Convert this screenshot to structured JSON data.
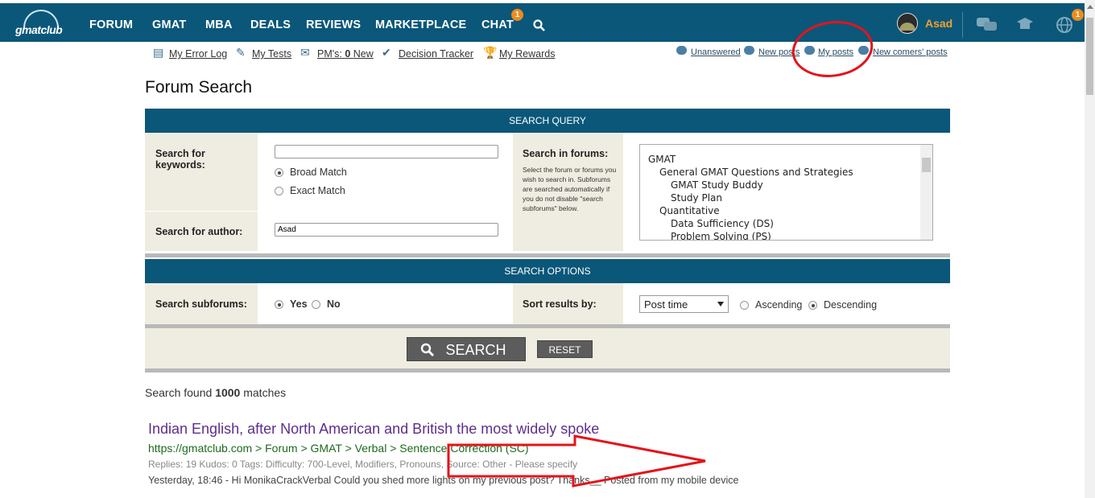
{
  "header": {
    "logo_text": "gmatclub",
    "nav": [
      "FORUM",
      "GMAT",
      "MBA",
      "DEALS",
      "REVIEWS",
      "MARKETPLACE",
      "CHAT"
    ],
    "chat_badge": "1",
    "username": "Asad",
    "globe_badge": "1"
  },
  "sublinks": {
    "error_log": "My Error Log",
    "tests": "My Tests",
    "pms_prefix": "PM's:",
    "pms_count": "0",
    "pms_new": "New",
    "decision_tracker": "Decision Tracker",
    "rewards": "My Rewards"
  },
  "quicklinks": {
    "unanswered": "Unanswered",
    "new_posts": "New posts",
    "my_posts": "My posts",
    "new_comers": "New comers' posts"
  },
  "page_title": "Forum Search",
  "query": {
    "header": "SEARCH QUERY",
    "keywords_label": "Search for keywords:",
    "keywords_value": "",
    "broad": "Broad Match",
    "exact": "Exact Match",
    "author_label": "Search for author:",
    "author_value": "Asad",
    "forums_label": "Search in forums:",
    "forums_help": "Select the forum or forums you wish to search in. Subforums are searched automatically if you do not disable \"search subforums\" below.",
    "forums": [
      "GMAT",
      "General GMAT Questions and Strategies",
      "GMAT Study Buddy",
      "Study Plan",
      "Quantitative",
      "Data Sufficiency (DS)",
      "Problem Solving (PS)"
    ]
  },
  "options": {
    "header": "SEARCH OPTIONS",
    "subforums_label": "Search subforums:",
    "yes": "Yes",
    "no": "No",
    "sort_label": "Sort results by:",
    "sort_value": "Post time",
    "ascending": "Ascending",
    "descending": "Descending"
  },
  "buttons": {
    "search": "SEARCH",
    "reset": "RESET"
  },
  "results": {
    "found_prefix": "Search found",
    "found_count": "1000",
    "found_suffix": "matches",
    "items": [
      {
        "title": "Indian English, after North American and British the most widely spoke",
        "url": "https://gmatclub.com > Forum > GMAT > Verbal > Sentence Correction (SC)",
        "meta": "Replies: 19   Kudos: 0   Tags: Difficulty: 700-Level,  Modifiers,  Pronouns,  Source: Other - Please specify",
        "snippet": "Yesterday, 18:46 - Hi MonikaCrackVerbal Could you shed more lights on my previous post? Thanks__ Posted from my mobile device"
      }
    ]
  },
  "colors": {
    "brand": "#0b5779",
    "annotation": "#e3141b",
    "badge": "#f08a1c"
  }
}
